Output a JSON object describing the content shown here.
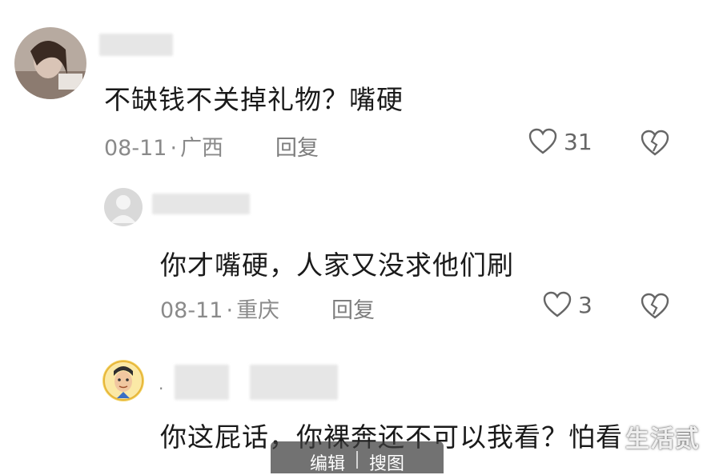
{
  "comments": [
    {
      "text": "不缺钱不关掉礼物？嘴硬",
      "date": "08-11",
      "location": "广西",
      "reply_label": "回复",
      "like_count": "31"
    },
    {
      "text": "你才嘴硬，人家又没求他们刷",
      "date": "08-11",
      "location": "重庆",
      "reply_label": "回复",
      "like_count": "3"
    },
    {
      "text": "你这屁话，你裸奔还不可以我看？怕看"
    }
  ],
  "watermark": "生活贰",
  "toolbar": {
    "edit_label": "编辑",
    "search_label": "搜图"
  },
  "icons": {
    "like": "heart-outline-icon",
    "dislike": "broken-heart-icon"
  },
  "colors": {
    "text": "#1a1a1a",
    "meta": "#8a8a8a",
    "icon": "#666666"
  }
}
